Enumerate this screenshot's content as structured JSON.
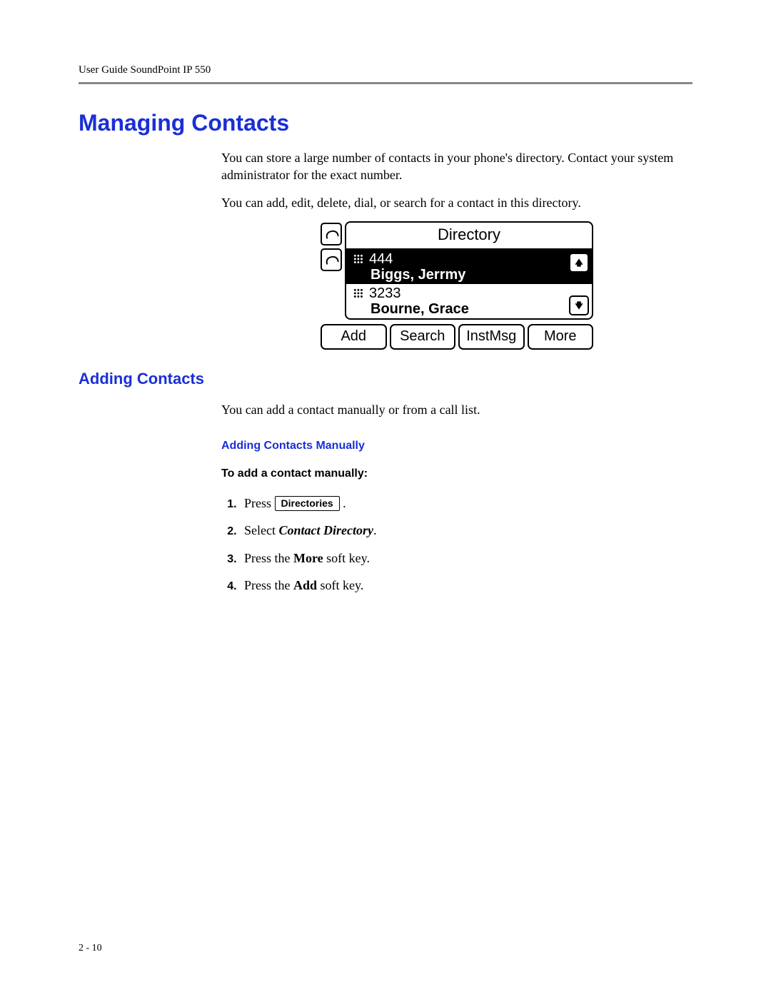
{
  "header": {
    "running_head": "User Guide SoundPoint IP 550"
  },
  "h1": "Managing Contacts",
  "intro_p1": "You can store a large number of contacts in your phone's directory. Contact your system administrator for the exact number.",
  "intro_p2": "You can add, edit, delete, dial, or search for a contact in this directory.",
  "screen": {
    "title": "Directory",
    "entries": [
      {
        "number": "444",
        "name": "Biggs, Jerrmy",
        "selected": true
      },
      {
        "number": "3233",
        "name": "Bourne, Grace",
        "selected": false
      }
    ],
    "softkeys": [
      "Add",
      "Search",
      "InstMsg",
      "More"
    ]
  },
  "h2": "Adding Contacts",
  "adding_p1": "You can add a contact manually or from a call list.",
  "h3": "Adding Contacts Manually",
  "h4": "To add a contact manually:",
  "steps": {
    "s1_a": "Press ",
    "s1_key": "Directories",
    "s1_b": " .",
    "s2_a": "Select ",
    "s2_em": "Contact Directory",
    "s2_b": ".",
    "s3_a": "Press the ",
    "s3_b": "More",
    "s3_c": " soft key.",
    "s4_a": "Press the ",
    "s4_b": "Add",
    "s4_c": " soft key."
  },
  "page_number": "2 - 10"
}
